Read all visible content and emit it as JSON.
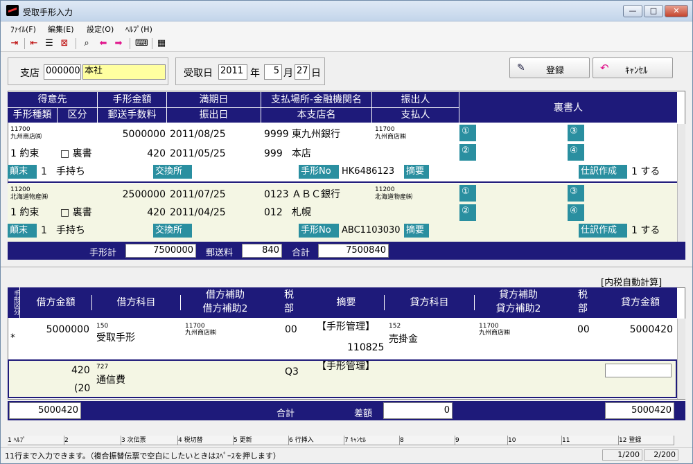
{
  "window": {
    "title": "受取手形入力",
    "min": "—",
    "max": "□",
    "close": "✕"
  },
  "menu": [
    "ﾌｧｲﾙ(F)",
    "編集(E)",
    "設定(O)",
    "ﾍﾙﾌﾟ(H)"
  ],
  "header": {
    "branch_label": "支店",
    "branch_code": "000000",
    "branch_name": "本社",
    "date_label": "受取日",
    "year": "2011",
    "year_unit": "年",
    "month": "5",
    "month_unit": "月",
    "day": "27",
    "day_unit": "日",
    "register": "登録",
    "cancel": "ｷｬﾝｾﾙ"
  },
  "upper_headers": {
    "row1": [
      "得意先",
      "手形金額",
      "満期日",
      "支払場所-金融機関名",
      "振出人"
    ],
    "row2": [
      "手形種類",
      "区分",
      "郵送手数料",
      "振出日",
      "本支店名",
      "支払人"
    ],
    "endorser": "裏書人"
  },
  "bills": [
    {
      "cust_code": "11700",
      "cust_name": "九州商店㈱",
      "amount": "5000000",
      "due": "2011/08/25",
      "bank_code": "9999",
      "bank_name": "東九州銀行",
      "drawer_code": "11700",
      "drawer_name": "九州商店㈱",
      "type": "1 約束",
      "urasho": "□ 裏書",
      "fee": "420",
      "issue": "2011/05/25",
      "branch_code": "999",
      "branch_name": "本店",
      "end_label": "顛末",
      "end_val": "1",
      "end_text": "手持ち",
      "exch": "交換所",
      "no_label": "手形No",
      "no_val": "HK6486123",
      "memo": "摘要",
      "shiwake": "仕訳作成",
      "shiwake_val": "1 する"
    },
    {
      "cust_code": "11200",
      "cust_name": "北海道物産㈱",
      "amount": "2500000",
      "due": "2011/07/25",
      "bank_code": "0123",
      "bank_name": "ＡＢＣ銀行",
      "drawer_code": "11200",
      "drawer_name": "北海道物産㈱",
      "type": "1 約束",
      "urasho": "□ 裏書",
      "fee": "420",
      "issue": "2011/04/25",
      "branch_code": "012",
      "branch_name": "札幌",
      "end_label": "顛末",
      "end_val": "1",
      "end_text": "手持ち",
      "exch": "交換所",
      "no_label": "手形No",
      "no_val": "ABC1103030",
      "memo": "摘要",
      "shiwake": "仕訳作成",
      "shiwake_val": "1 する"
    }
  ],
  "circles": [
    "①",
    "②",
    "③",
    "④"
  ],
  "totals": {
    "bill_total_label": "手形計",
    "bill_total": "7500000",
    "postage_label": "郵送料",
    "postage": "840",
    "sum_label": "合計",
    "sum": "7500840"
  },
  "auto_tax": "[内税自動計算]",
  "lower_headers": {
    "kubun": "手形区分",
    "debit_amount": "借方金額",
    "debit_account": "借方科目",
    "debit_sub": "借方補助",
    "debit_sub2": "借方補助2",
    "tax_code": "税",
    "tax_part": "部",
    "memo": "摘要",
    "credit_account": "貸方科目",
    "credit_sub": "貸方補助",
    "credit_sub2": "貸方補助2",
    "credit_amount": "貸方金額"
  },
  "journal": [
    {
      "mark": "*",
      "amount": "5000000",
      "acct_code": "150",
      "acct_name": "受取手形",
      "sub_code": "11700",
      "sub_name": "九州商店㈱",
      "tax": "00",
      "memo": "【手形管理】",
      "memo_no": "110825",
      "c_code": "152",
      "c_name": "売掛金",
      "c_sub_code": "11700",
      "c_sub_name": "九州商店㈱",
      "c_tax": "00",
      "c_amount": "5000420"
    },
    {
      "amount": "420",
      "amount2": "(20",
      "acct_code": "727",
      "acct_name": "通信費",
      "tax": "Q3",
      "memo": "【手形管理】"
    }
  ],
  "lower_totals": {
    "debit": "5000420",
    "label": "合計",
    "diff_label": "差額",
    "diff": "0",
    "credit": "5000420"
  },
  "fkeys": [
    "1 ﾍﾙﾌﾟ",
    "2",
    "3 次伝票",
    "4 税切替",
    "5 更新",
    "6 行挿入",
    "7 ｷｬﾝｾﾙ",
    "8",
    "9",
    "10",
    "11",
    "12 登録"
  ],
  "status": {
    "message": "11行まで入力できます。（複合振替伝票で空白にしたいときはｽﾍﾟｰｽを押します）",
    "page1": "1/200",
    "page2": "2/200"
  }
}
